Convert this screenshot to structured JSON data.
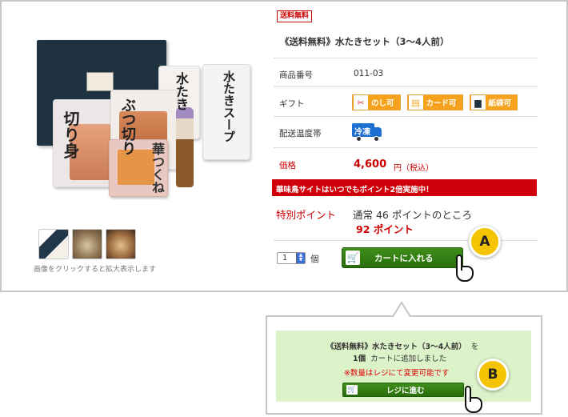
{
  "product": {
    "free_shipping_badge": "送料無料",
    "title": "《送料無料》水たきセット（3〜4人前）",
    "image_caption": "画像をクリックすると拡大表示します",
    "packaging_text": {
      "pack_a": "水たき",
      "pack_b": "水たきスープ",
      "pack_c": "切り身",
      "pack_d": "ぶつ切り",
      "pack_e": "華つくね"
    }
  },
  "details": {
    "product_number_label": "商品番号",
    "product_number_value": "011-03",
    "gift_label": "ギフト",
    "gift_options": [
      "のし可",
      "カード可",
      "紙袋可"
    ],
    "delivery_temp_label": "配送温度帯",
    "delivery_temp_value": "冷凍",
    "price_label": "価格",
    "price_value": "4,600",
    "price_tax": "円（税込）"
  },
  "promo": {
    "banner": "華味鳥サイトはいつでもポイント2倍実施中！"
  },
  "points": {
    "label": "特別ポイント",
    "normal_text": "通常 46 ポイントのところ",
    "special_text": "92 ポイント"
  },
  "purchase": {
    "quantity": "1",
    "quantity_unit": "個",
    "add_to_cart_label": "カートに入れる"
  },
  "markers": {
    "a": "A",
    "b": "B"
  },
  "popup": {
    "product_title": "《送料無料》水たきセット（3〜4人前）",
    "to_particle": "を",
    "added_qty": "1個",
    "added_text": "カートに追加しました",
    "note": "※数量はレジにて変更可能です",
    "checkout_label": "レジに進む"
  },
  "colors": {
    "accent_red": "#d0000b",
    "cart_green": "#2a6e0c",
    "gift_orange": "#f7a21c",
    "frozen_blue": "#1d6fd2",
    "popup_bg": "#dcf2c8",
    "marker_yellow": "#f5c400"
  },
  "icons": {
    "gift_noshi": "noshi-icon",
    "gift_card": "card-icon",
    "gift_bag": "paper-bag-icon",
    "frozen": "frozen-truck-icon",
    "cart": "cart-icon",
    "pointer": "hand-pointer-icon"
  }
}
